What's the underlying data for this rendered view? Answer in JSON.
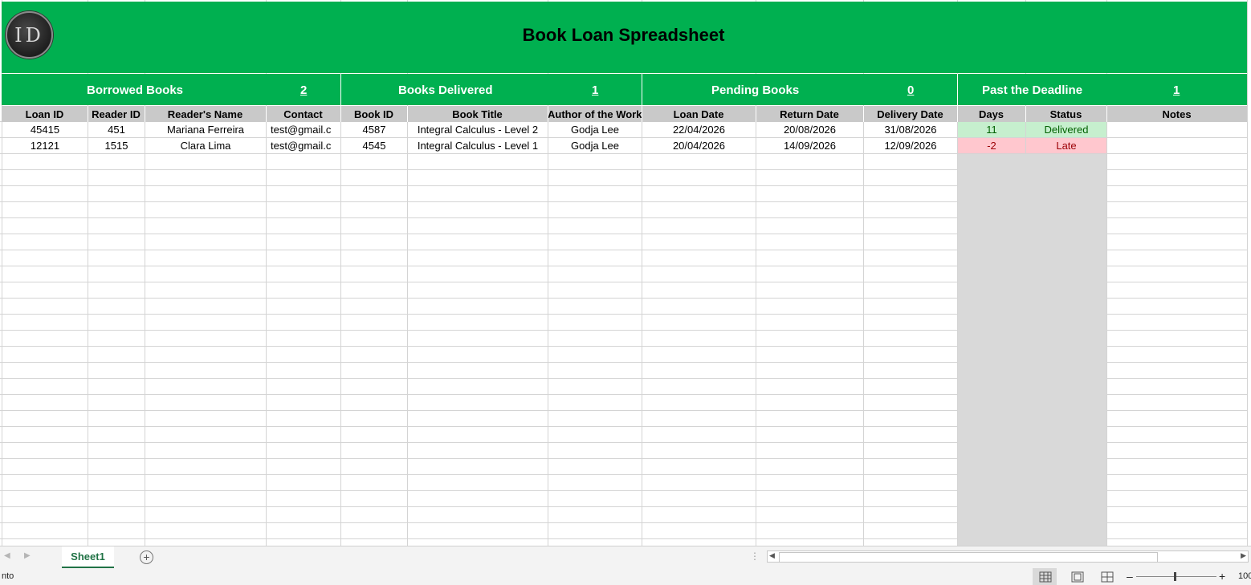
{
  "title": "Book Loan Spreadsheet",
  "logo_text": "ID",
  "summary": {
    "borrowed_label": "Borrowed Books",
    "borrowed_value": "2",
    "delivered_label": "Books Delivered",
    "delivered_value": "1",
    "pending_label": "Pending Books",
    "pending_value": "0",
    "past_label": "Past the Deadline",
    "past_value": "1"
  },
  "columns": [
    "Loan ID",
    "Reader ID",
    "Reader's Name",
    "Contact",
    "Book ID",
    "Book Title",
    "Author of the Work",
    "Loan Date",
    "Return Date",
    "Delivery Date",
    "Days",
    "Status",
    "Notes"
  ],
  "rows": [
    [
      "45415",
      "451",
      "Mariana Ferreira",
      "test@gmail.c",
      "4587",
      "Integral Calculus - Level 2",
      "Godja Lee",
      "22/04/2026",
      "20/08/2026",
      "31/08/2026",
      "11",
      "Delivered",
      ""
    ],
    [
      "12121",
      "1515",
      "Clara Lima",
      "test@gmail.c",
      "4545",
      "Integral Calculus - Level 1",
      "Godja Lee",
      "20/04/2026",
      "14/09/2026",
      "12/09/2026",
      "-2",
      "Late",
      ""
    ]
  ],
  "status_colors": {
    "delivered_bg": "#c6efce",
    "delivered_fg": "#006100",
    "late_bg": "#ffc7ce",
    "late_fg": "#9c0006",
    "banner": "#00b050"
  },
  "tabs": {
    "sheet1": "Sheet1"
  },
  "status": {
    "left_text": "nto",
    "zoom": "100"
  },
  "icons": {
    "add_sheet": "plus-circle-icon",
    "scroll_left": "triangle-left-icon",
    "scroll_right": "triangle-right-icon",
    "normal_view": "grid-icon",
    "page_layout": "page-layout-icon",
    "page_break": "page-break-icon"
  }
}
